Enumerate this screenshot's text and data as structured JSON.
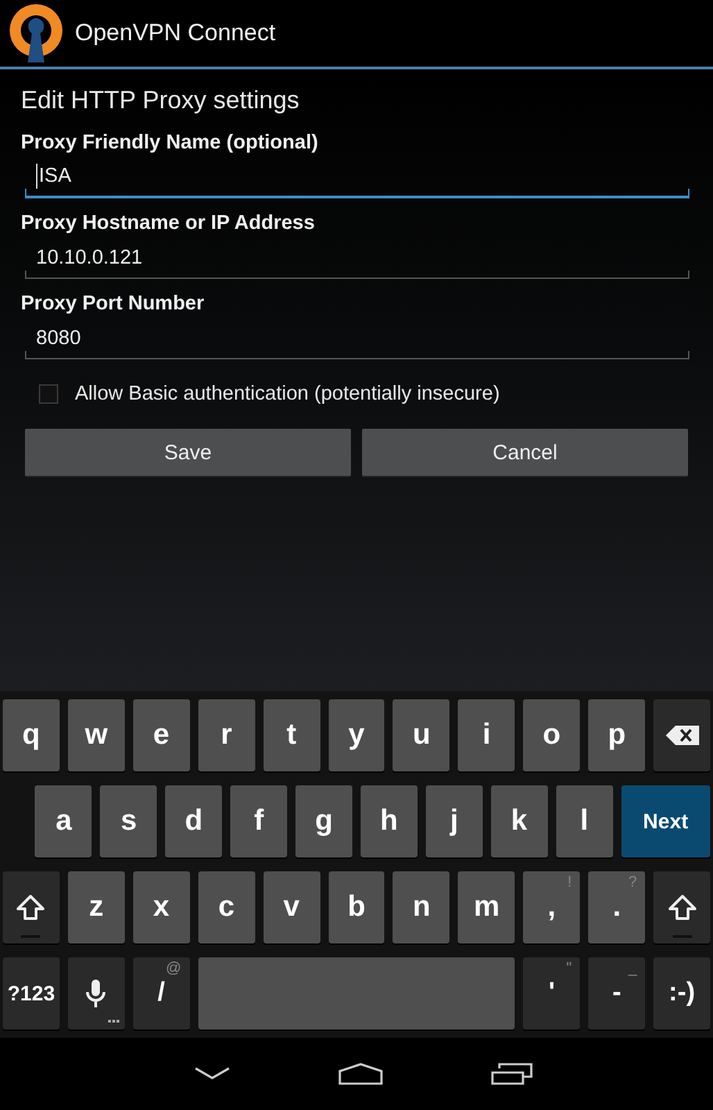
{
  "app_bar": {
    "title": "OpenVPN Connect"
  },
  "form": {
    "heading": "Edit HTTP Proxy settings",
    "fields": [
      {
        "label": "Proxy Friendly Name (optional)",
        "value": "ISA",
        "focused": true
      },
      {
        "label": "Proxy Hostname or IP Address",
        "value": "10.10.0.121",
        "focused": false
      },
      {
        "label": "Proxy Port Number",
        "value": "8080",
        "focused": false
      }
    ],
    "checkbox": {
      "label": "Allow Basic authentication (potentially insecure)",
      "checked": false
    },
    "buttons": [
      "Save",
      "Cancel"
    ]
  },
  "keyboard": {
    "rows": [
      {
        "keys": [
          {
            "kind": "letter",
            "label": "q"
          },
          {
            "kind": "letter",
            "label": "w"
          },
          {
            "kind": "letter",
            "label": "e"
          },
          {
            "kind": "letter",
            "label": "r"
          },
          {
            "kind": "letter",
            "label": "t"
          },
          {
            "kind": "letter",
            "label": "y"
          },
          {
            "kind": "letter",
            "label": "u"
          },
          {
            "kind": "letter",
            "label": "i"
          },
          {
            "kind": "letter",
            "label": "o"
          },
          {
            "kind": "letter",
            "label": "p"
          },
          {
            "kind": "backspace"
          }
        ]
      },
      {
        "keys": [
          {
            "kind": "letter",
            "label": "a"
          },
          {
            "kind": "letter",
            "label": "s"
          },
          {
            "kind": "letter",
            "label": "d"
          },
          {
            "kind": "letter",
            "label": "f"
          },
          {
            "kind": "letter",
            "label": "g"
          },
          {
            "kind": "letter",
            "label": "h"
          },
          {
            "kind": "letter",
            "label": "j"
          },
          {
            "kind": "letter",
            "label": "k"
          },
          {
            "kind": "letter",
            "label": "l"
          },
          {
            "kind": "action",
            "label": "Next"
          }
        ]
      },
      {
        "keys": [
          {
            "kind": "shift"
          },
          {
            "kind": "letter",
            "label": "z"
          },
          {
            "kind": "letter",
            "label": "x"
          },
          {
            "kind": "letter",
            "label": "c"
          },
          {
            "kind": "letter",
            "label": "v"
          },
          {
            "kind": "letter",
            "label": "b"
          },
          {
            "kind": "letter",
            "label": "n"
          },
          {
            "kind": "letter",
            "label": "m"
          },
          {
            "kind": "letter",
            "label": ",",
            "hint": "!"
          },
          {
            "kind": "letter",
            "label": ".",
            "hint": "?"
          },
          {
            "kind": "shift"
          }
        ]
      },
      {
        "keys": [
          {
            "kind": "function",
            "label": "?123"
          },
          {
            "kind": "mic"
          },
          {
            "kind": "function",
            "label": "/",
            "hint": "@"
          },
          {
            "kind": "space"
          },
          {
            "kind": "function",
            "label": "'",
            "hint": "\""
          },
          {
            "kind": "function",
            "label": "-",
            "hint": "_"
          },
          {
            "kind": "function",
            "label": ":-)"
          }
        ]
      }
    ]
  },
  "nav_bar": {
    "buttons": [
      {
        "kind": "hide_keyboard"
      },
      {
        "kind": "home"
      },
      {
        "kind": "recents"
      }
    ]
  }
}
